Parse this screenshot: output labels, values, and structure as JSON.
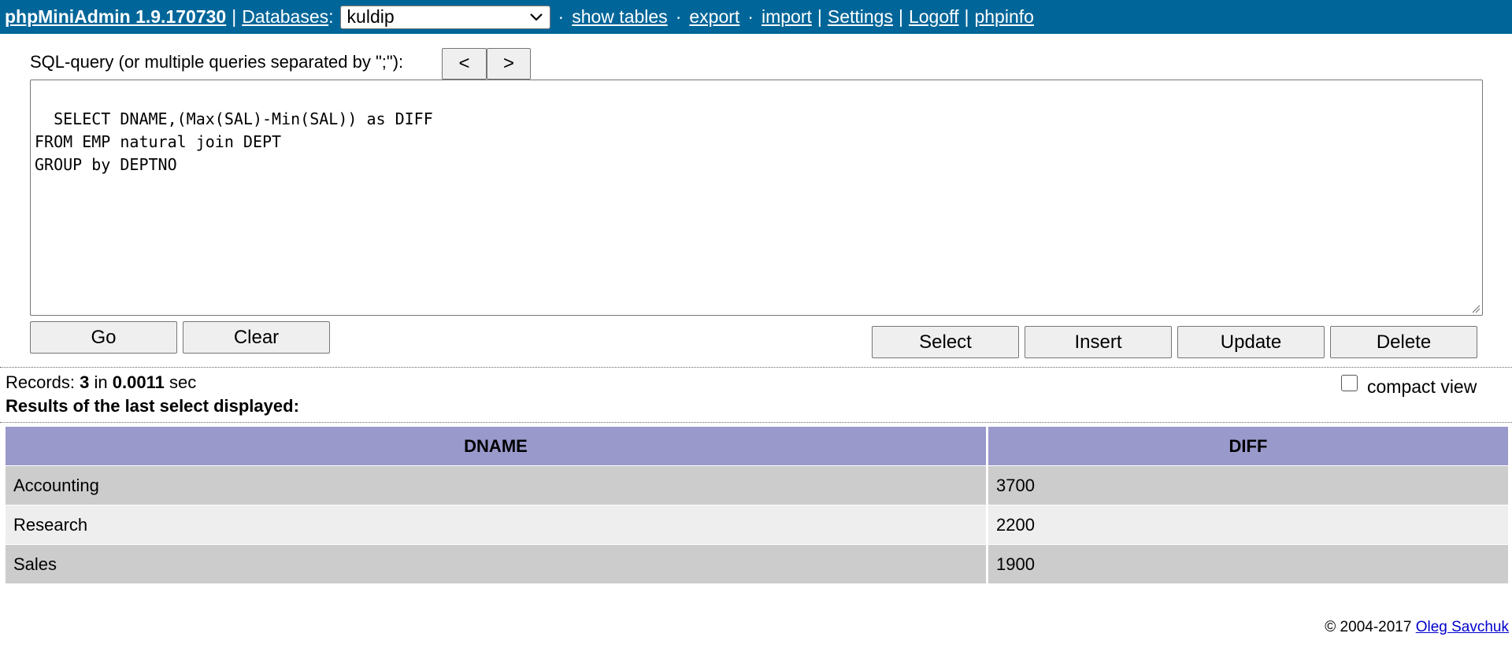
{
  "topbar": {
    "brand": "phpMiniAdmin 1.9.170730",
    "sep": "|",
    "databases_label": "Databases",
    "colon": ":",
    "selected_db": "kuldip",
    "dot": "·",
    "show_tables": "show tables",
    "export": "export",
    "import": "import",
    "settings": "Settings",
    "logoff": "Logoff",
    "phpinfo": "phpinfo"
  },
  "query": {
    "label": "SQL-query (or multiple queries separated by \";\"):",
    "prev": "<",
    "next": ">",
    "sql": "SELECT DNAME,(Max(SAL)-Min(SAL)) as DIFF\nFROM EMP natural join DEPT\nGROUP by DEPTNO",
    "go": "Go",
    "clear": "Clear",
    "select": "Select",
    "insert": "Insert",
    "update": "Update",
    "delete": "Delete"
  },
  "status": {
    "records_label": "Records: ",
    "records_count": "3",
    "in": " in ",
    "time": "0.0011",
    "sec": " sec",
    "results_note": "Results of the last select displayed:",
    "compact_view": "compact view",
    "compact_checked": false
  },
  "table": {
    "columns": [
      "DNAME",
      "DIFF"
    ],
    "rows": [
      [
        "Accounting",
        "3700"
      ],
      [
        "Research",
        "2200"
      ],
      [
        "Sales",
        "1900"
      ]
    ]
  },
  "footer": {
    "copyright": "© 2004-2017 ",
    "author": "Oleg Savchuk"
  },
  "colors": {
    "topbar": "#006699",
    "table_header": "#9999cc",
    "row_odd": "#cccccc",
    "row_even": "#eeeeee"
  }
}
